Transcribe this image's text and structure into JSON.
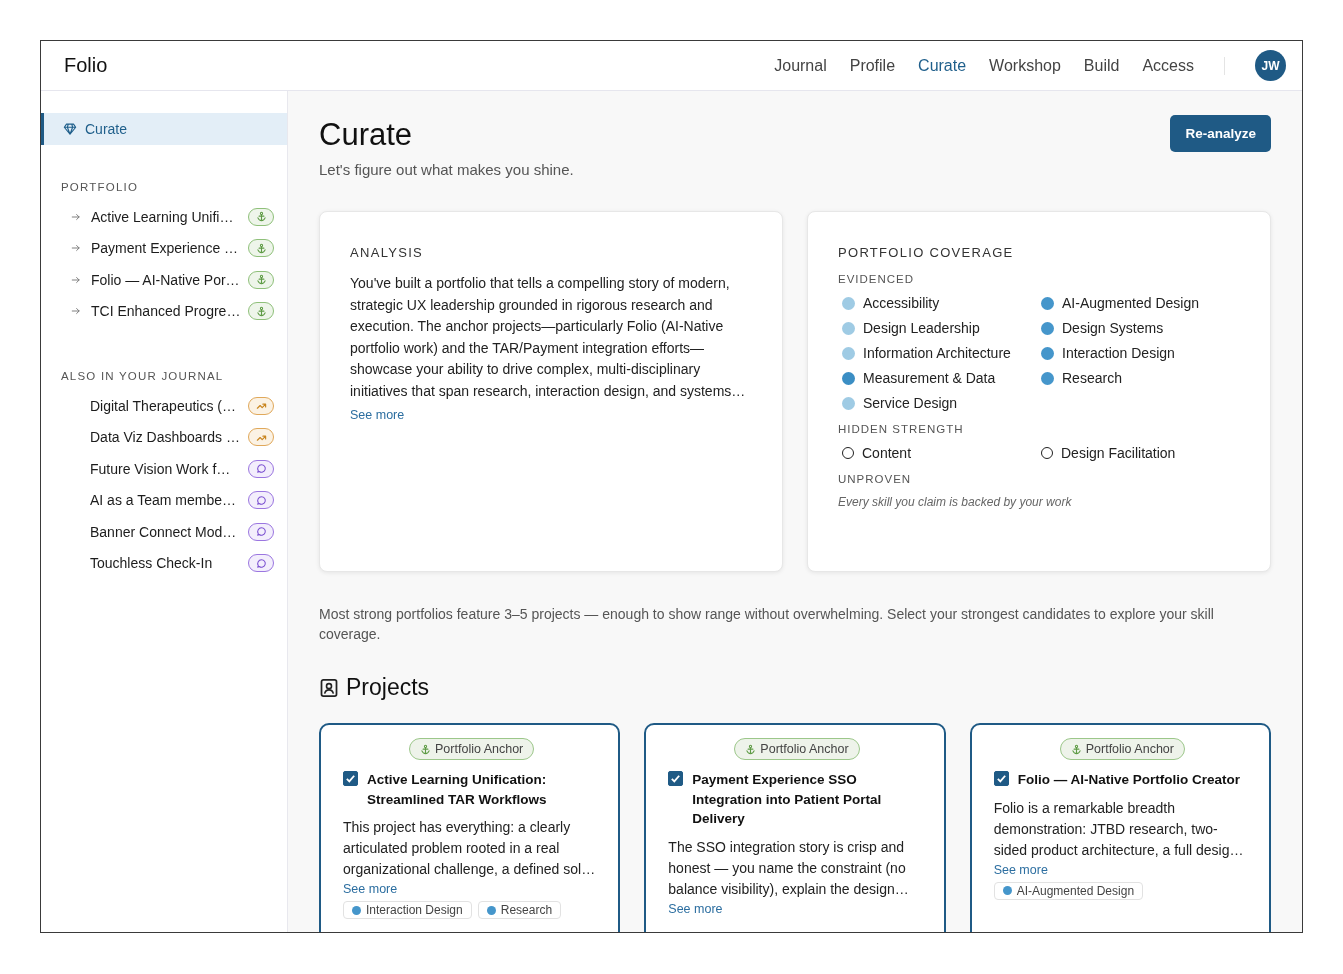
{
  "app": {
    "title": "Folio"
  },
  "nav": [
    {
      "label": "Journal",
      "selected": false
    },
    {
      "label": "Profile",
      "selected": false
    },
    {
      "label": "Curate",
      "selected": true
    },
    {
      "label": "Workshop",
      "selected": false
    },
    {
      "label": "Build",
      "selected": false
    },
    {
      "label": "Access",
      "selected": false
    }
  ],
  "user": {
    "initials": "JW"
  },
  "sidebar": {
    "active_item": {
      "label": "Curate",
      "selected": true
    },
    "sections": [
      {
        "title": "PORTFOLIO",
        "kind": "portfolio",
        "items": [
          {
            "label": "Active Learning Unifi…",
            "kind": "anchor"
          },
          {
            "label": "Payment Experience …",
            "kind": "anchor"
          },
          {
            "label": "Folio — AI-Native Por…",
            "kind": "anchor"
          },
          {
            "label": "TCI Enhanced Progre…",
            "kind": "anchor"
          }
        ]
      },
      {
        "title": "ALSO IN YOUR JOURNAL",
        "kind": "journal",
        "items": [
          {
            "label": "Digital Therapeutics (…",
            "kind": "trending"
          },
          {
            "label": "Data Viz Dashboards …",
            "kind": "trending"
          },
          {
            "label": "Future Vision Work f…",
            "kind": "comment"
          },
          {
            "label": "AI as a Team membe…",
            "kind": "comment"
          },
          {
            "label": "Banner Connect Mod…",
            "kind": "comment"
          },
          {
            "label": "Touchless Check-In",
            "kind": "comment"
          }
        ]
      }
    ]
  },
  "page": {
    "title": "Curate",
    "subtitle": "Let's figure out what makes you shine.",
    "action": "Re-analyze"
  },
  "analysis": {
    "heading": "ANALYSIS",
    "text": "You've built a portfolio that tells a compelling story of modern, strategic UX leadership grounded in rigorous research and execution. The anchor projects—particularly Folio (AI-Native portfolio work) and the TAR/Payment integration efforts—showcase your ability to drive complex, multi-disciplinary initiatives that span research, interaction design, and systems…",
    "link": "See more"
  },
  "coverage": {
    "heading": "PORTFOLIO COVERAGE",
    "groups": [
      {
        "title": "EVIDENCED",
        "kind": "evidenced",
        "skills": [
          {
            "label": "Accessibility",
            "color": "#9fcbe4"
          },
          {
            "label": "Design Leadership",
            "color": "#9fcbe4"
          },
          {
            "label": "Information Architecture",
            "color": "#9fcbe4"
          },
          {
            "label": "Measurement & Data",
            "color": "#3b8ec4"
          },
          {
            "label": "Service Design",
            "color": "#9fcbe4"
          },
          {
            "label": "AI-Augmented Design",
            "color": "#4596cb"
          },
          {
            "label": "Design Systems",
            "color": "#4596cb"
          },
          {
            "label": "Interaction Design",
            "color": "#4596cb"
          },
          {
            "label": "Research",
            "color": "#4596cb"
          }
        ]
      },
      {
        "title": "HIDDEN STRENGTH",
        "kind": "hidden",
        "skills": [
          {
            "label": "Content"
          },
          {
            "label": "Design Facilitation"
          }
        ]
      },
      {
        "title": "UNPROVEN",
        "kind": "unproven",
        "note": "Every skill you claim is backed by your work"
      }
    ]
  },
  "hint": "Most strong portfolios feature 3–5 projects — enough to show range without overwhelming. Select your strongest candidates to explore your skill coverage.",
  "projects": {
    "heading": "Projects",
    "items": [
      {
        "badge": "Portfolio Anchor",
        "checked": true,
        "title": "Active Learning Unification: Streamlined TAR Workflows",
        "summary": "This project has everything: a clearly articulated problem rooted in a real organizational challenge, a defined sol…",
        "link": "See more",
        "tags": [
          {
            "label": "Interaction Design",
            "color": "#4596cb"
          },
          {
            "label": "Research",
            "color": "#4596cb"
          }
        ]
      },
      {
        "badge": "Portfolio Anchor",
        "checked": true,
        "title": "Payment Experience SSO Integration into Patient Portal Delivery",
        "summary": "The SSO integration story is crisp and honest — you name the constraint (no balance visibility), explain the design…",
        "link": "See more"
      },
      {
        "badge": "Portfolio Anchor",
        "checked": true,
        "title": "Folio — AI-Native Portfolio Creator",
        "summary": "Folio is a remarkable breadth demonstration: JTBD research, two-sided product architecture, a full desig…",
        "link": "See more",
        "tags": [
          {
            "label": "AI-Augmented Design",
            "color": "#4596cb"
          }
        ]
      }
    ]
  }
}
